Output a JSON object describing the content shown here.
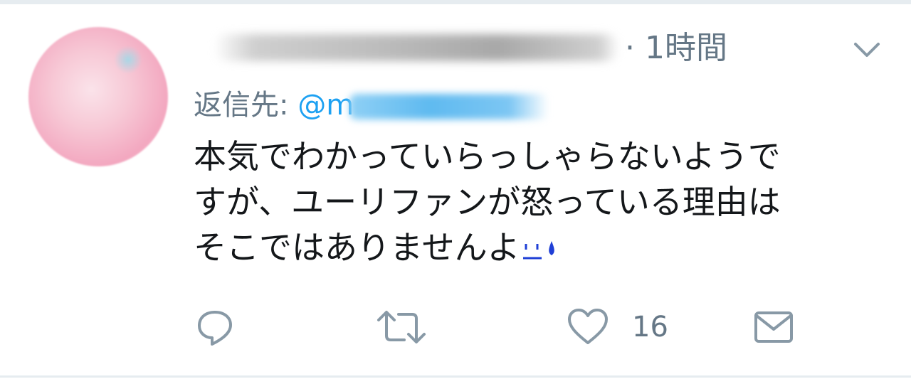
{
  "tweet": {
    "time": "· 1時間",
    "reply_label": "返信先: ",
    "reply_handle_prefix": "@m",
    "text_lines": [
      "本気でわかっていらっしゃらないようで",
      "すが、ユーリファンが怒っている理由は",
      "そこではありませんよ"
    ]
  },
  "actions": {
    "like_count": "16"
  },
  "colors": {
    "accent": "#1da1f2",
    "muted": "#657786",
    "text": "#14171a",
    "divider": "#e6ecf0"
  },
  "icons": {
    "reply": "reply-icon",
    "retweet": "retweet-icon",
    "like": "heart-icon",
    "message": "envelope-icon",
    "menu": "chevron-down-icon"
  }
}
